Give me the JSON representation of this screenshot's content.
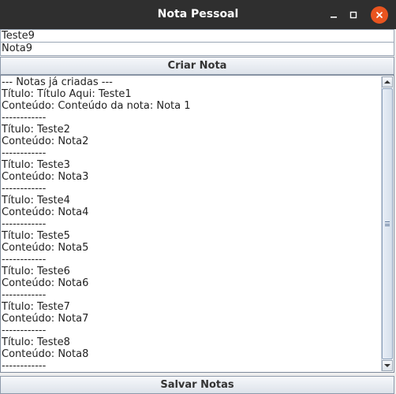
{
  "window": {
    "title": "Nota Pessoal",
    "controls": {
      "minimize": "minimize-icon",
      "maximize": "maximize-icon",
      "close": "close-icon"
    },
    "close_color": "#e9541f"
  },
  "form": {
    "title_value": "Teste9",
    "content_value": "Nota9",
    "create_button": "Criar Nota",
    "save_button": "Salvar Notas"
  },
  "notes_area": {
    "lines": [
      "--- Notas já criadas ---",
      "Título: Título Aqui: Teste1",
      "Conteúdo: Conteúdo da nota: Nota 1",
      "------------",
      "Título: Teste2",
      "Conteúdo: Nota2",
      "------------",
      "Título: Teste3",
      "Conteúdo: Nota3",
      "------------",
      "Título: Teste4",
      "Conteúdo: Nota4",
      "------------",
      "Título: Teste5",
      "Conteúdo: Nota5",
      "------------",
      "Título: Teste6",
      "Conteúdo: Nota6",
      "------------",
      "Título: Teste7",
      "Conteúdo: Nota7",
      "------------",
      "Título: Teste8",
      "Conteúdo: Nota8",
      "------------"
    ]
  }
}
